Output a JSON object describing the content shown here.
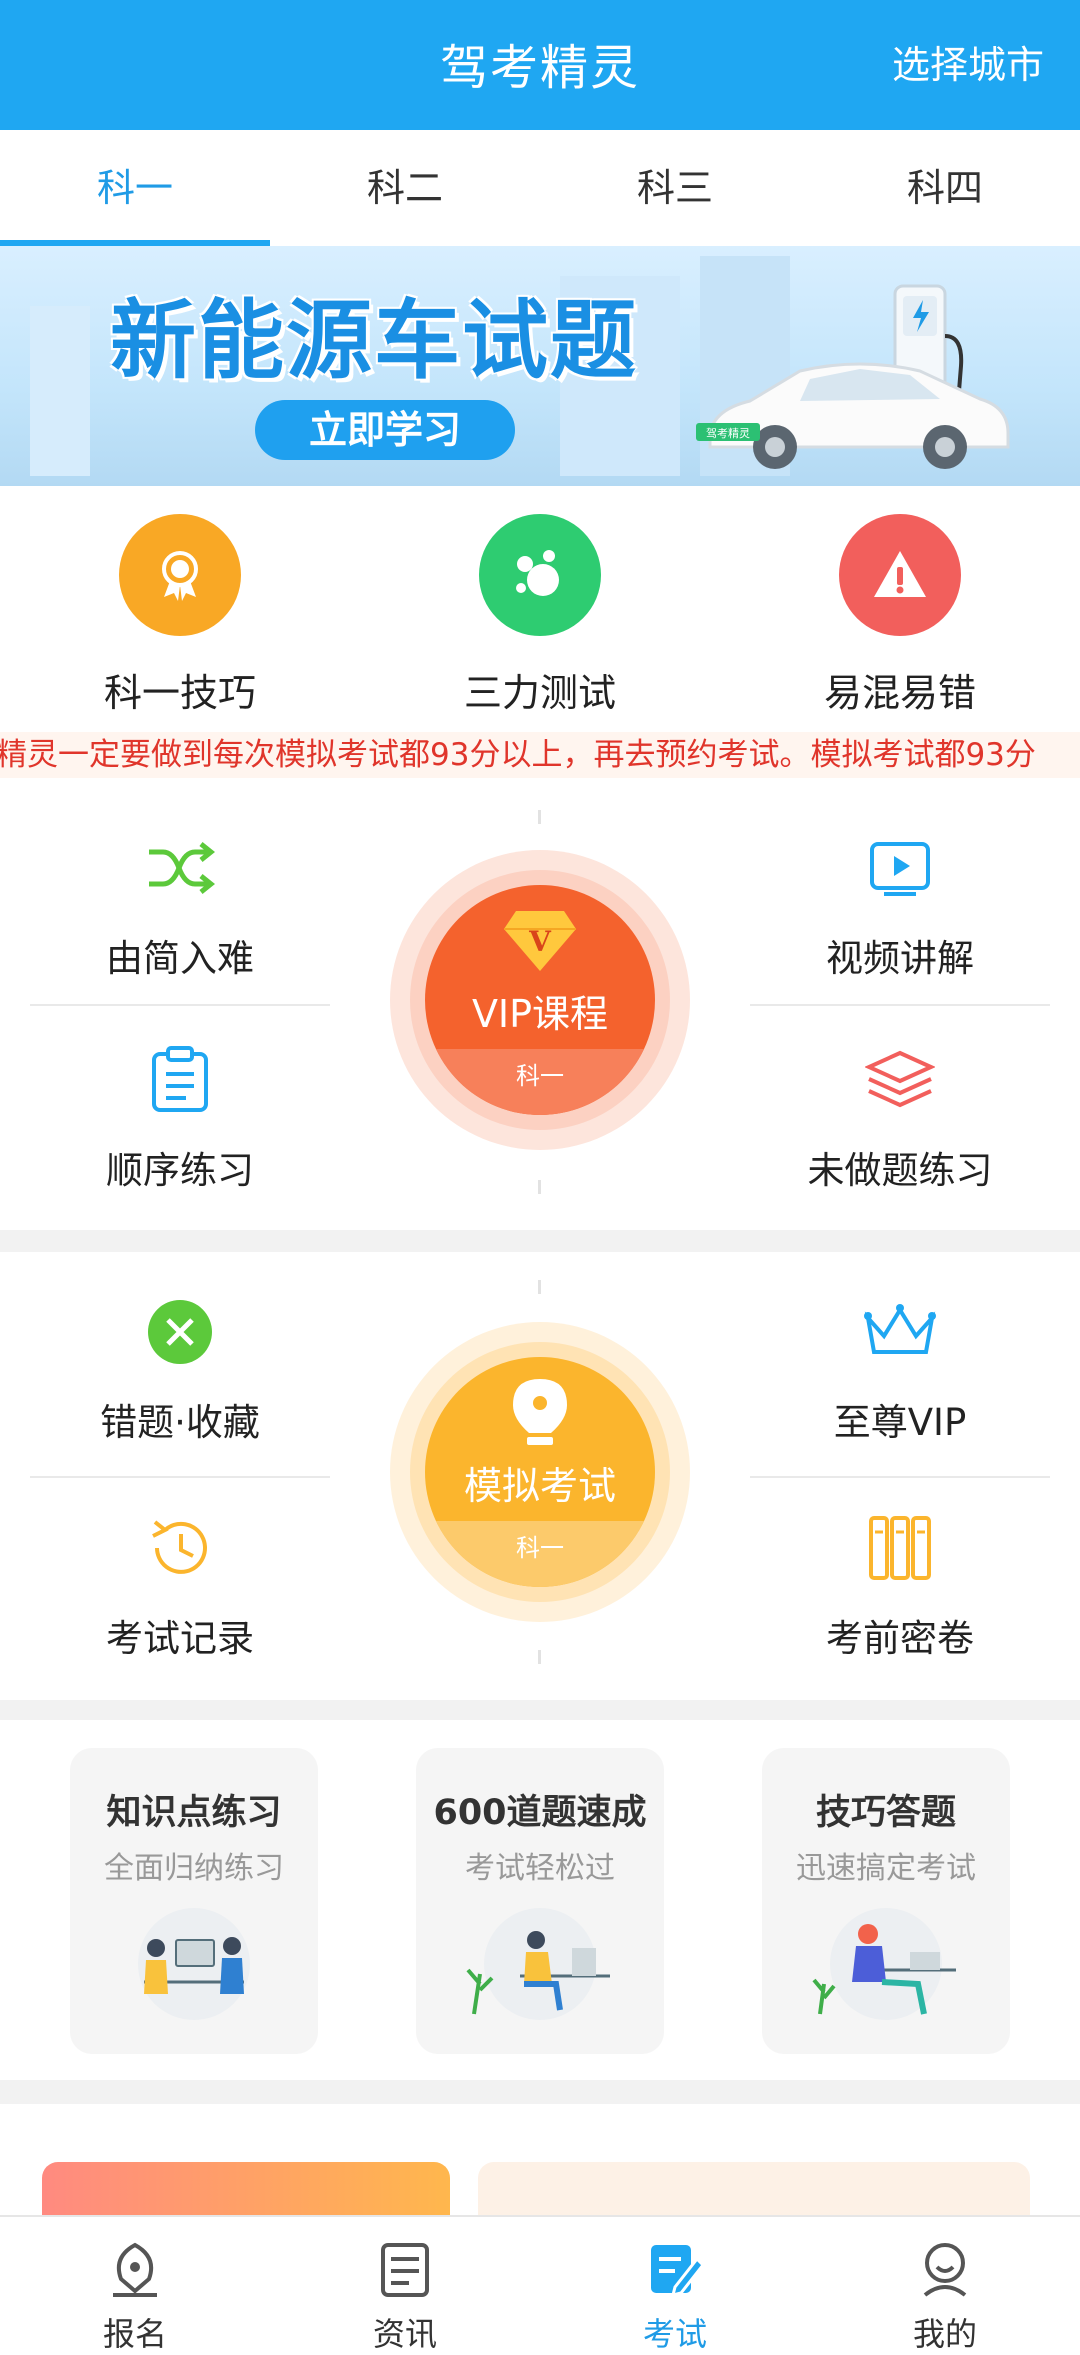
{
  "header": {
    "title": "驾考精灵",
    "city_button": "选择城市"
  },
  "tabs": [
    {
      "label": "科一"
    },
    {
      "label": "科二"
    },
    {
      "label": "科三"
    },
    {
      "label": "科四"
    }
  ],
  "banner": {
    "title": "新能源车试题",
    "button": "立即学习",
    "plate": "驾考精灵"
  },
  "quick_icons": [
    {
      "label": "科一技巧",
      "icon": "medal-icon",
      "color": "#f9a825"
    },
    {
      "label": "三力测试",
      "icon": "bubbles-icon",
      "color": "#2ecc71"
    },
    {
      "label": "易混易错",
      "icon": "warning-icon",
      "color": "#f25f5c"
    }
  ],
  "marquee": {
    "text": "精灵一定要做到每次模拟考试都93分以上，再去预约考试。模拟考试都93分"
  },
  "practice": {
    "left_top": {
      "label": "由简入难",
      "icon": "shuffle-icon"
    },
    "left_bottom": {
      "label": "顺序练习",
      "icon": "clipboard-icon"
    },
    "right_top": {
      "label": "视频讲解",
      "icon": "video-icon"
    },
    "right_bottom": {
      "label": "未做题练习",
      "icon": "layers-icon"
    },
    "center": {
      "title": "VIP课程",
      "sub": "科一",
      "badge": "V"
    }
  },
  "exam": {
    "left_top": {
      "label": "错题·收藏",
      "icon": "close-circle-icon"
    },
    "left_bottom": {
      "label": "考试记录",
      "icon": "history-icon"
    },
    "right_top": {
      "label": "至尊VIP",
      "icon": "crown-icon"
    },
    "right_bottom": {
      "label": "考前密卷",
      "icon": "books-icon"
    },
    "center": {
      "title": "模拟考试",
      "sub": "科一"
    }
  },
  "cards": [
    {
      "title": "知识点练习",
      "subtitle": "全面归纳练习"
    },
    {
      "title": "600道题速成",
      "subtitle": "考试轻松过"
    },
    {
      "title": "技巧答题",
      "subtitle": "迅速搞定考试"
    }
  ],
  "bottom_nav": [
    {
      "label": "报名",
      "icon": "pen-icon"
    },
    {
      "label": "资讯",
      "icon": "news-icon"
    },
    {
      "label": "考试",
      "icon": "exam-edit-icon",
      "active": true
    },
    {
      "label": "我的",
      "icon": "profile-icon"
    }
  ],
  "colors": {
    "primary": "#1fa7f2",
    "vip": "#f4622d",
    "exam": "#fbb52d",
    "marquee_text": "#e0352b"
  }
}
